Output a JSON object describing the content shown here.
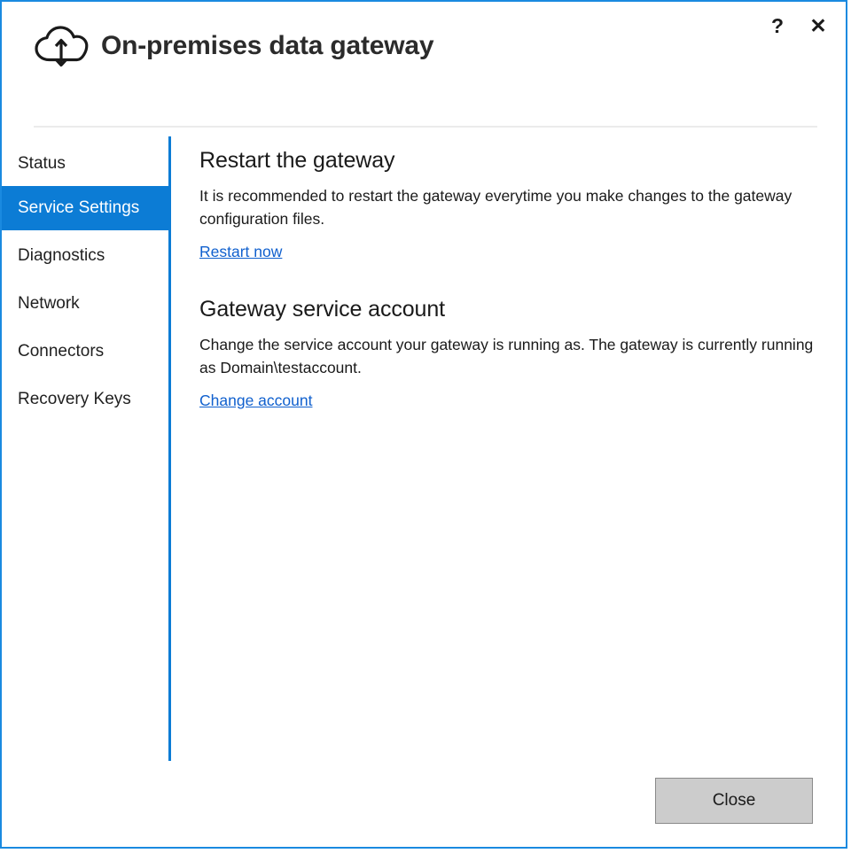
{
  "window": {
    "title": "On-premises data gateway",
    "logo_icon": "cloud-sync-icon",
    "help_icon": "?",
    "close_icon": "✕",
    "border_color": "#1a8ae0"
  },
  "sidebar": {
    "accent_color": "#0c7cd5",
    "items": [
      {
        "label": "Status",
        "selected": false
      },
      {
        "label": "Service Settings",
        "selected": true
      },
      {
        "label": "Diagnostics",
        "selected": false
      },
      {
        "label": "Network",
        "selected": false
      },
      {
        "label": "Connectors",
        "selected": false
      },
      {
        "label": "Recovery Keys",
        "selected": false
      }
    ]
  },
  "main": {
    "sections": [
      {
        "heading": "Restart the gateway",
        "body": "It is recommended to restart the gateway everytime you make changes to the gateway configuration files.",
        "link": "Restart now"
      },
      {
        "heading": "Gateway service account",
        "body": "Change the service account your gateway is running as. The gateway is currently running as Domain\\testaccount.",
        "link": "Change account"
      }
    ],
    "link_color": "#1060ce"
  },
  "footer": {
    "close_label": "Close"
  }
}
